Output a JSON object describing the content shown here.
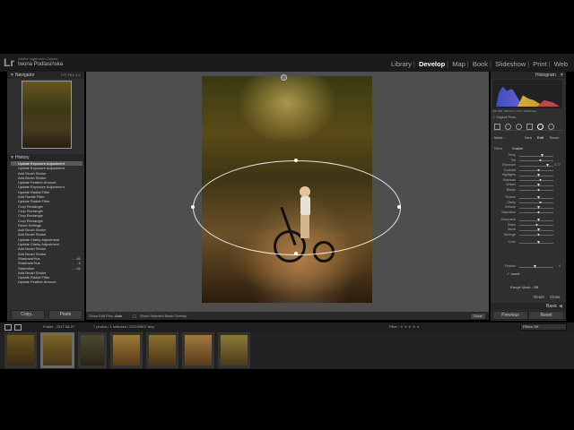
{
  "app": {
    "logo": "Lr",
    "subtitle": "Adobe Lightroom Classic",
    "user": "Iwona Podlasińska"
  },
  "modules": [
    "Library",
    "Develop",
    "Map",
    "Book",
    "Slideshow",
    "Print",
    "Web"
  ],
  "active_module": "Develop",
  "navigator": {
    "title": "Navigator",
    "options": "FIT  FILL  1:1"
  },
  "history": {
    "title": "History",
    "items": [
      {
        "label": "Update Exposure Adjustment",
        "v1": "",
        "v2": ""
      },
      {
        "label": "Update Exposure Adjustment",
        "v1": "",
        "v2": ""
      },
      {
        "label": "Add Brush Stroke",
        "v1": "",
        "v2": ""
      },
      {
        "label": "Add Brush Stroke",
        "v1": "",
        "v2": ""
      },
      {
        "label": "Update Feather Amount",
        "v1": "",
        "v2": ""
      },
      {
        "label": "Update Exposure Adjustment",
        "v1": "",
        "v2": ""
      },
      {
        "label": "Update Radial Filter",
        "v1": "",
        "v2": ""
      },
      {
        "label": "Add Radial Filter",
        "v1": "",
        "v2": ""
      },
      {
        "label": "Update Radial Filter",
        "v1": "",
        "v2": ""
      },
      {
        "label": "Crop Rectangle",
        "v1": "",
        "v2": ""
      },
      {
        "label": "Crop Rectangle",
        "v1": "",
        "v2": ""
      },
      {
        "label": "Crop Rectangle",
        "v1": "",
        "v2": ""
      },
      {
        "label": "Crop Rectangle",
        "v1": "",
        "v2": ""
      },
      {
        "label": "Reset Settings",
        "v1": "",
        "v2": ""
      },
      {
        "label": "Add Brush Stroke",
        "v1": "",
        "v2": ""
      },
      {
        "label": "Add Brush Stroke",
        "v1": "",
        "v2": ""
      },
      {
        "label": "Update Clarity Adjustment",
        "v1": "",
        "v2": ""
      },
      {
        "label": "Update Clarity Adjustment",
        "v1": "",
        "v2": ""
      },
      {
        "label": "Add Brush Stroke",
        "v1": "",
        "v2": ""
      },
      {
        "label": "Add Brush Stroke",
        "v1": "",
        "v2": ""
      },
      {
        "label": "Shadows/Hus",
        "v1": "-",
        "v2": "-41"
      },
      {
        "label": "Shadows/Hus",
        "v1": "-",
        "v2": "-1"
      },
      {
        "label": "Saturation",
        "v1": "-",
        "v2": "-41"
      },
      {
        "label": "Add Brush Stroke",
        "v1": "",
        "v2": ""
      },
      {
        "label": "Update Radial Filter",
        "v1": "",
        "v2": ""
      },
      {
        "label": "Update Feather Amount",
        "v1": "",
        "v2": ""
      }
    ],
    "selected_index": 0
  },
  "left_buttons": {
    "copy": "Copy...",
    "paste": "Paste"
  },
  "toolbar": {
    "show_edit_pins_label": "Show Edit Pins :",
    "show_edit_pins_value": "Auto",
    "overlay_label": "Show Selected Mask Overlay",
    "done": "Done"
  },
  "histogram": {
    "title": "Histogram",
    "values": [
      "ISO 200",
      "135 mm",
      "f / 2.0",
      "1/1250 sec"
    ],
    "original_photo": "Original Photo"
  },
  "mask": {
    "label": "Mask :",
    "new": "New",
    "edit": "Edit",
    "brush": "Brush"
  },
  "effect": {
    "label": "Effect :",
    "value": "Custom"
  },
  "sliders": [
    {
      "name": "Temp",
      "value": ""
    },
    {
      "name": "Tint",
      "value": ""
    },
    {
      "name": "Exposure",
      "value": "0.77"
    },
    {
      "name": "Contrast",
      "value": ""
    },
    {
      "name": "Highlights",
      "value": ""
    },
    {
      "name": "Shadows",
      "value": ""
    },
    {
      "name": "Whites",
      "value": ""
    },
    {
      "name": "Blacks",
      "value": ""
    },
    {
      "name": "Texture",
      "value": ""
    },
    {
      "name": "Clarity",
      "value": ""
    },
    {
      "name": "Dehaze",
      "value": ""
    },
    {
      "name": "Saturation",
      "value": ""
    },
    {
      "name": "Sharpness",
      "value": ""
    },
    {
      "name": "Noise",
      "value": ""
    },
    {
      "name": "Moire",
      "value": ""
    },
    {
      "name": "Defringe",
      "value": ""
    },
    {
      "name": "Color",
      "value": ""
    }
  ],
  "feather": {
    "label": "Feather",
    "value": "0",
    "invert_label": "Invert"
  },
  "range_mask": {
    "label": "Range Mask :",
    "value": "Off"
  },
  "panel_buttons": {
    "reset": "Reset",
    "close": "Close",
    "basic": "Basic"
  },
  "bottom_buttons": {
    "previous": "Previous",
    "reset": "Reset"
  },
  "filmbar": {
    "folder": "Folder : 2017-08-27",
    "info": "7 photos / 1 selected / DSC00807.dng",
    "filter_label": "Filter :",
    "filter_value": "Filters Off"
  },
  "filmstrip_count": 7,
  "filmstrip_selected": 1
}
